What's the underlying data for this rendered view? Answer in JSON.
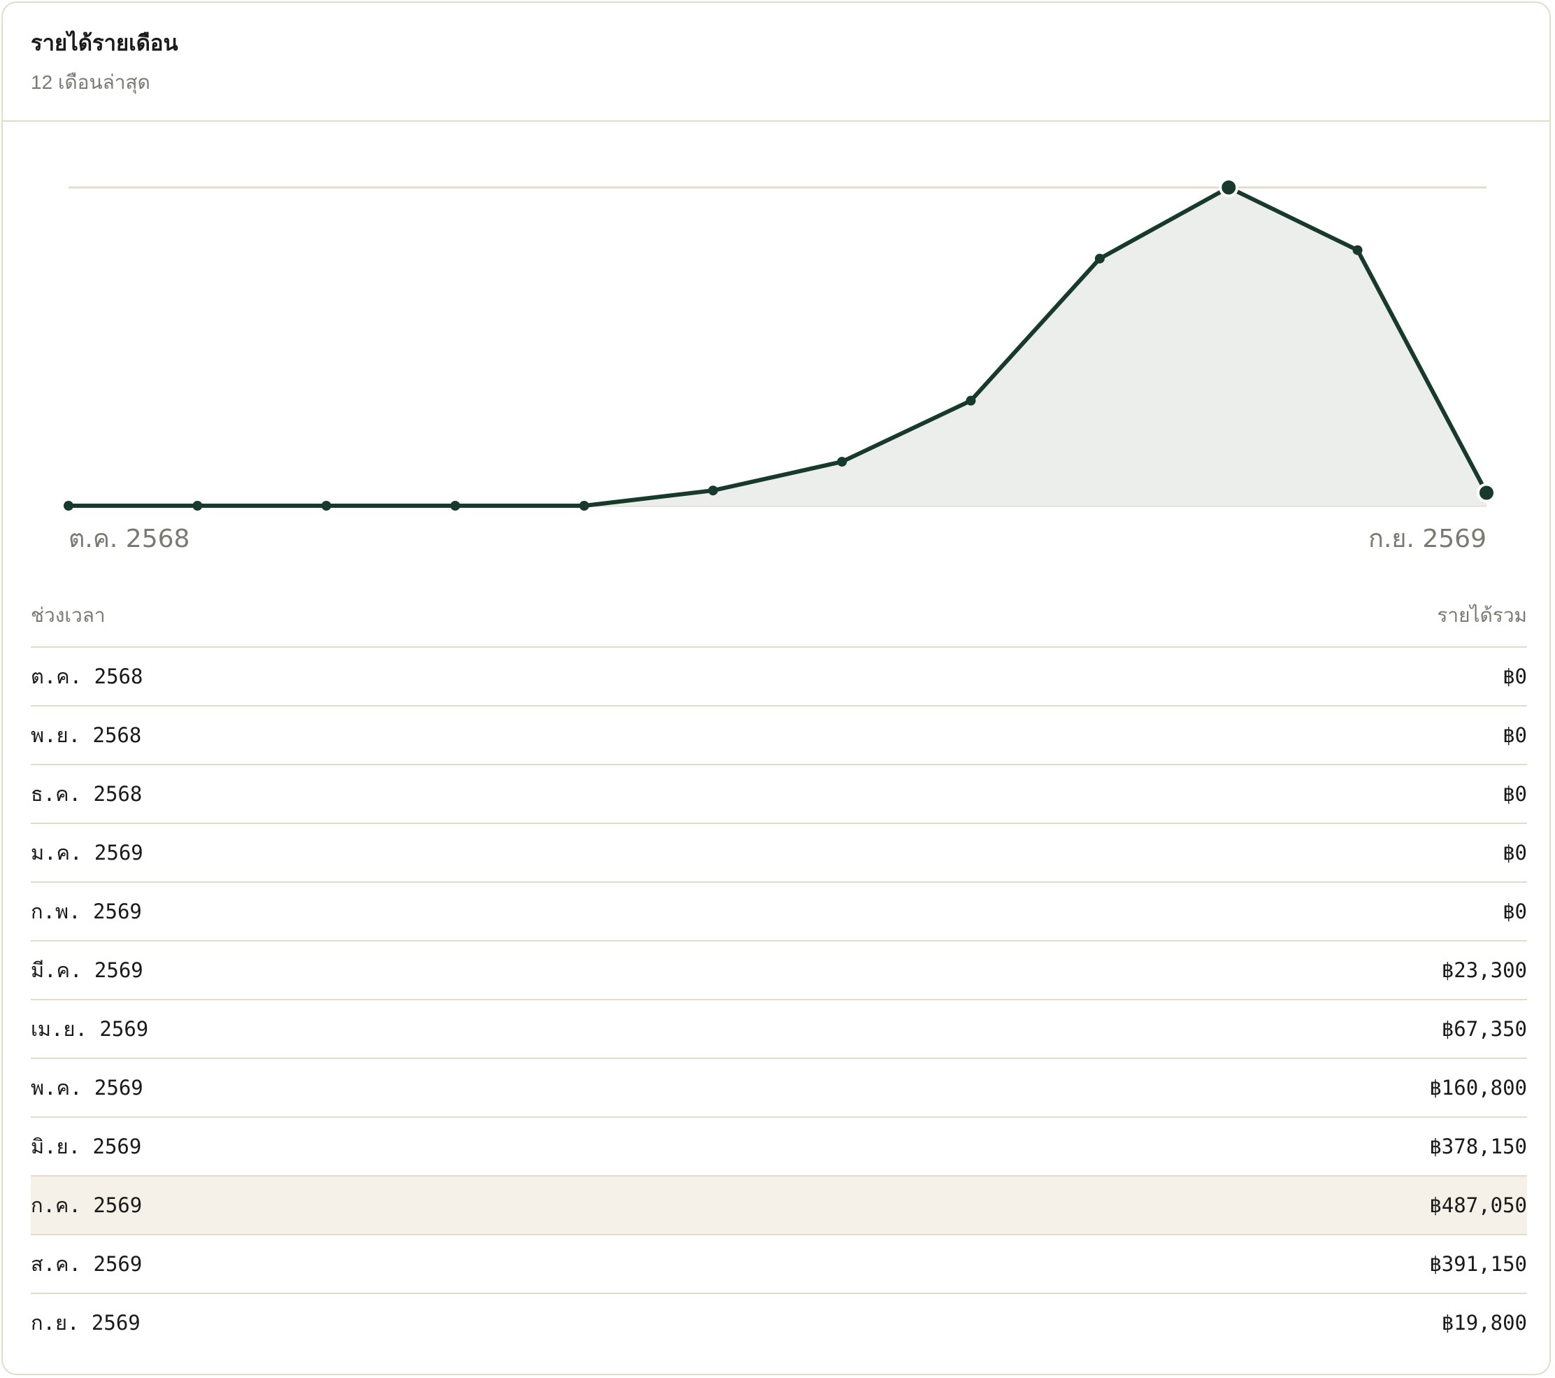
{
  "header": {
    "title": "รายได้รายเดือน",
    "subtitle": "12 เดือนล่าสุด"
  },
  "colors": {
    "line": "#173a2c",
    "area_fill": "#eceeec",
    "grid": "#e4dccb",
    "highlight_row": "#f5f1e9",
    "muted_text": "#7a7a72"
  },
  "chart_data": {
    "type": "area",
    "categories": [
      "ต.ค. 2568",
      "พ.ย. 2568",
      "ธ.ค. 2568",
      "ม.ค. 2569",
      "ก.พ. 2569",
      "มี.ค. 2569",
      "เม.ย. 2569",
      "พ.ค. 2569",
      "มิ.ย. 2569",
      "ก.ค. 2569",
      "ส.ค. 2569",
      "ก.ย. 2569"
    ],
    "values": [
      0,
      0,
      0,
      0,
      0,
      23300,
      67350,
      160800,
      378150,
      487050,
      391150,
      19800
    ],
    "ylim": [
      0,
      487050
    ],
    "x_tick_labels": {
      "first": "ต.ค. 2568",
      "last": "ก.ย. 2569"
    },
    "highlighted_points": [
      "ก.ค. 2569",
      "ก.ย. 2569"
    ],
    "grid": true
  },
  "table": {
    "columns": {
      "period": "ช่วงเวลา",
      "total": "รายได้รวม"
    },
    "rows": [
      {
        "period": "ต.ค. 2568",
        "total": "฿0"
      },
      {
        "period": "พ.ย. 2568",
        "total": "฿0"
      },
      {
        "period": "ธ.ค. 2568",
        "total": "฿0"
      },
      {
        "period": "ม.ค. 2569",
        "total": "฿0"
      },
      {
        "period": "ก.พ. 2569",
        "total": "฿0"
      },
      {
        "period": "มี.ค. 2569",
        "total": "฿23,300"
      },
      {
        "period": "เม.ย. 2569",
        "total": "฿67,350"
      },
      {
        "period": "พ.ค. 2569",
        "total": "฿160,800"
      },
      {
        "period": "มิ.ย. 2569",
        "total": "฿378,150"
      },
      {
        "period": "ก.ค. 2569",
        "total": "฿487,050",
        "highlighted": true
      },
      {
        "period": "ส.ค. 2569",
        "total": "฿391,150"
      },
      {
        "period": "ก.ย. 2569",
        "total": "฿19,800"
      }
    ]
  }
}
